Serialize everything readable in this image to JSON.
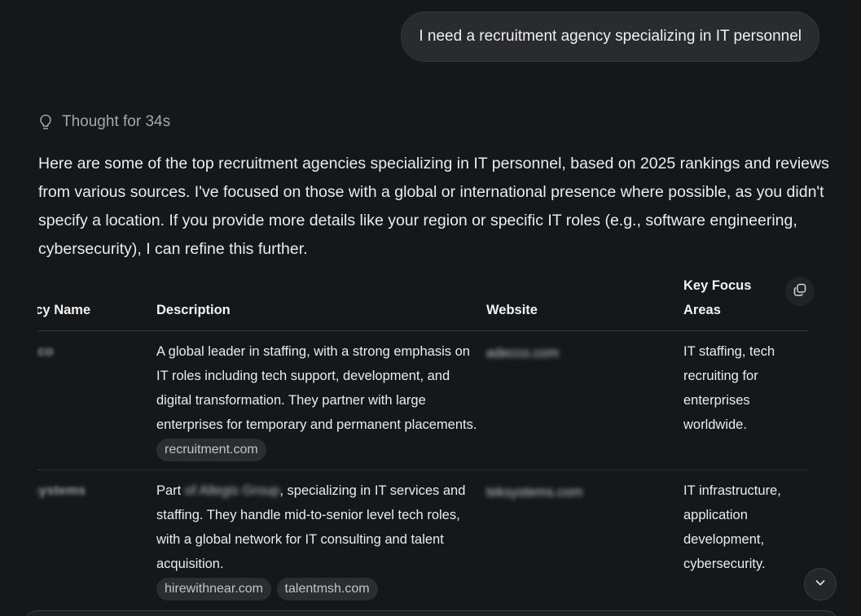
{
  "user_message": "I need a recruitment agency specializing in IT personnel",
  "thought": {
    "icon": "lightbulb-icon",
    "label": "Thought for 34s"
  },
  "answer": {
    "intro": "Here are some of the top recruitment agencies specializing in IT personnel, based on 2025 rankings and reviews from various sources. I've focused on those with a global or international presence where possible, as you didn't specify a location. If you provide more details like your region or specific IT roles (e.g., software engineering, cybersecurity), I can refine this further."
  },
  "table": {
    "headers": {
      "name": "ency Name",
      "description": "Description",
      "website": "Website",
      "focus": "Key Focus Areas"
    },
    "rows": [
      {
        "name": "ecco",
        "description": "A global leader in staffing, with a strong emphasis on IT roles including tech support, development, and digital transformation. They partner with large enterprises for temporary and permanent placements.",
        "chips": [
          "recruitment.com"
        ],
        "website": "adecco.com",
        "focus": "IT staffing, tech recruiting for enterprises worldwide."
      },
      {
        "name": "Xsystems",
        "description_prefix": "Part",
        "description_redacted": "of Allegis Group",
        "description_suffix": ", specializing in IT services and staffing. They handle mid-to-senior level tech roles, with a global network for IT consulting and talent acquisition.",
        "chips": [
          "hirewithnear.com",
          "talentmsh.com"
        ],
        "website": "teksystems.com",
        "focus": "IT infrastructure, application development, cybersecurity."
      }
    ]
  },
  "icons": {
    "copy": "copy-icon",
    "scroll": "chevron-down-icon"
  },
  "colors": {
    "background": "#161719",
    "bubble": "#2a2b2e",
    "chip": "#2c2d31",
    "text": "#ececec",
    "muted": "#a7a7a9"
  }
}
